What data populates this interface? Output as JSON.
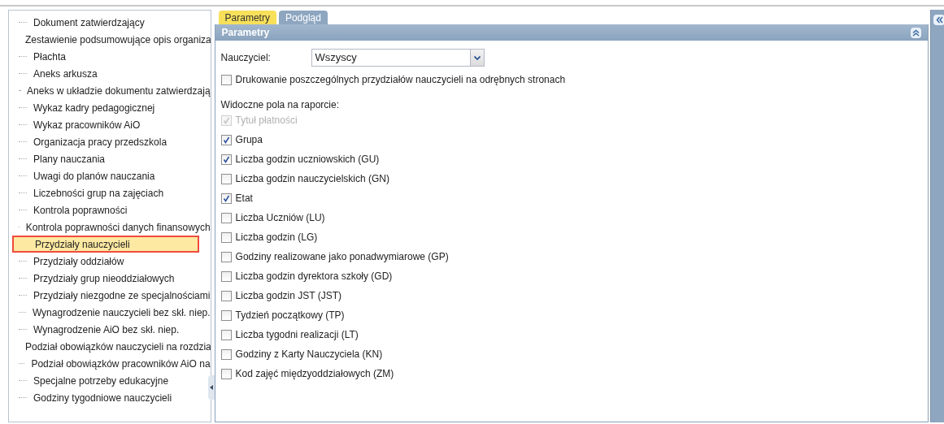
{
  "tree": {
    "items": [
      {
        "label": "Dokument zatwierdzający",
        "selected": false
      },
      {
        "label": "Zestawienie podsumowujące opis organiza",
        "selected": false
      },
      {
        "label": "Płachta",
        "selected": false
      },
      {
        "label": "Aneks arkusza",
        "selected": false
      },
      {
        "label": "Aneks w układzie dokumentu zatwierdzają",
        "selected": false
      },
      {
        "label": "Wykaz kadry pedagogicznej",
        "selected": false
      },
      {
        "label": "Wykaz pracowników AiO",
        "selected": false
      },
      {
        "label": "Organizacja pracy przedszkola",
        "selected": false
      },
      {
        "label": "Plany nauczania",
        "selected": false
      },
      {
        "label": "Uwagi do planów nauczania",
        "selected": false
      },
      {
        "label": "Liczebności grup na zajęciach",
        "selected": false
      },
      {
        "label": "Kontrola poprawności",
        "selected": false
      },
      {
        "label": "Kontrola poprawności danych finansowych",
        "selected": false
      },
      {
        "label": "Przydziały nauczycieli",
        "selected": true
      },
      {
        "label": "Przydziały oddziałów",
        "selected": false
      },
      {
        "label": "Przydziały grup nieoddziałowych",
        "selected": false
      },
      {
        "label": "Przydziały niezgodne ze specjalnościami",
        "selected": false
      },
      {
        "label": "Wynagrodzenie nauczycieli bez skł. niep.",
        "selected": false
      },
      {
        "label": "Wynagrodzenie AiO bez skł. niep.",
        "selected": false
      },
      {
        "label": "Podział obowiązków nauczycieli na rozdzia",
        "selected": false
      },
      {
        "label": "Podział obowiązków pracowników AiO na",
        "selected": false
      },
      {
        "label": "Specjalne potrzeby edukacyjne",
        "selected": false
      },
      {
        "label": "Godziny tygodniowe nauczycieli",
        "selected": false
      }
    ]
  },
  "tabs": [
    {
      "label": "Parametry",
      "selected": true
    },
    {
      "label": "Podgląd",
      "selected": false
    }
  ],
  "panel": {
    "title": "Parametry",
    "teacher": {
      "label": "Nauczyciel:",
      "value": "Wszyscy"
    },
    "separate_pages": {
      "label": "Drukowanie poszczególnych przydziałów nauczycieli na odrębnych stronach",
      "checked": false
    },
    "fields_heading": "Widoczne pola na raporcie:",
    "fields": [
      {
        "label": "Tytuł płatności",
        "checked": true,
        "disabled": true
      },
      {
        "label": "Grupa",
        "checked": true,
        "disabled": false
      },
      {
        "label": "Liczba godzin uczniowskich (GU)",
        "checked": true,
        "disabled": false
      },
      {
        "label": "Liczba godzin nauczycielskich (GN)",
        "checked": false,
        "disabled": false
      },
      {
        "label": "Etat",
        "checked": true,
        "disabled": false
      },
      {
        "label": "Liczba Uczniów (LU)",
        "checked": false,
        "disabled": false
      },
      {
        "label": "Liczba godzin (LG)",
        "checked": false,
        "disabled": false
      },
      {
        "label": "Godziny realizowane jako ponadwymiarowe (GP)",
        "checked": false,
        "disabled": false
      },
      {
        "label": "Liczba godzin dyrektora szkoły (GD)",
        "checked": false,
        "disabled": false
      },
      {
        "label": "Liczba godzin JST (JST)",
        "checked": false,
        "disabled": false
      },
      {
        "label": "Tydzień początkowy (TP)",
        "checked": false,
        "disabled": false
      },
      {
        "label": "Liczba tygodni realizacji (LT)",
        "checked": false,
        "disabled": false
      },
      {
        "label": "Godziny z Karty Nauczyciela (KN)",
        "checked": false,
        "disabled": false
      },
      {
        "label": "Kod zajęć międzyoddziałowych (ZM)",
        "checked": false,
        "disabled": false
      }
    ]
  }
}
